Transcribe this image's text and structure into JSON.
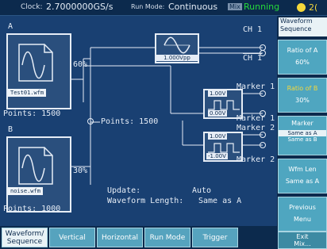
{
  "status": {
    "clock_label": "Clock:",
    "clock_value": "2.7000000GS/s",
    "runmode_label": "Run Mode:",
    "runmode_value": "Continuous",
    "run_badge": "Mix",
    "run_state": "Running",
    "page_number": "2("
  },
  "channels": {
    "ch1": "CH 1",
    "ch1_bar": "CH 1",
    "marker1_a": "Marker 1",
    "marker1_b": "Marker 1",
    "marker2_a": "Marker 2",
    "marker2_b": "Marker 2"
  },
  "signals": {
    "filter_value": "1.000Vpp",
    "m1_high": "1.00V",
    "m1_low": "0.00V",
    "m2_high": "1.00V",
    "m2_low": "-1.00V"
  },
  "wave_a": {
    "title": "A",
    "file": "Test01.wfm",
    "points": "Points: 1500",
    "ratio": "60%"
  },
  "wave_b": {
    "title": "B",
    "file": "noise.wfm",
    "points": "Points: 1000",
    "ratio": "30%"
  },
  "mix_points": "Points: 1500",
  "summary": {
    "update_label": "Update:",
    "update_value": "Auto",
    "length_label": "Waveform Length:",
    "length_value": "Same as A"
  },
  "side_menu": {
    "title_1": "Waveform",
    "title_2": "Sequence",
    "ratio_a_label": "Ratio of A",
    "ratio_a_value": "60%",
    "ratio_b_label": "Ratio of B",
    "ratio_b_value": "30%",
    "marker_label": "Marker",
    "marker_opt1": "Same as A",
    "marker_opt2": "Same as B",
    "wfm_len_label": "Wfm Len",
    "wfm_len_value": "Same as A",
    "prev_label": "Previous",
    "prev_sub": "Menu",
    "exit_label": "Exit",
    "exit_sub": "Mix..."
  },
  "tabs": [
    {
      "label": "Waveform/ Sequence"
    },
    {
      "label": "Vertical"
    },
    {
      "label": "Horizontal"
    },
    {
      "label": "Run Mode"
    },
    {
      "label": "Trigger"
    }
  ],
  "colors": {
    "run_state": "#26d93a",
    "badge": "#7b92ad",
    "accent": "#56a3be"
  }
}
